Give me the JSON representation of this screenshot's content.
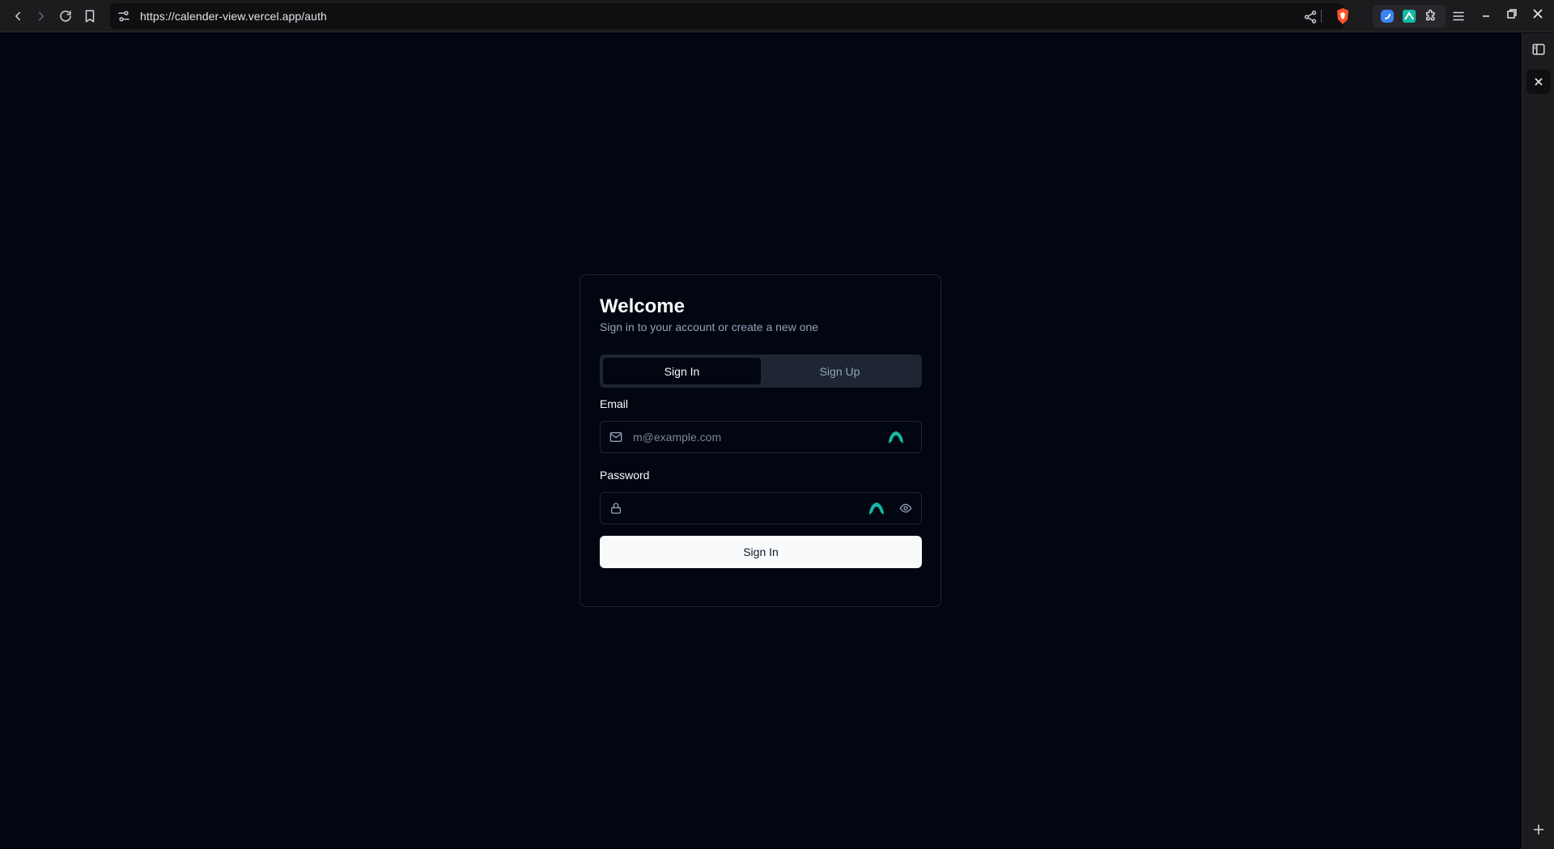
{
  "browser": {
    "url": "https://calender-view.vercel.app/auth"
  },
  "auth": {
    "title": "Welcome",
    "subtitle": "Sign in to your account or create a new one",
    "tabs": [
      {
        "label": "Sign In",
        "active": true
      },
      {
        "label": "Sign Up",
        "active": false
      }
    ],
    "email": {
      "label": "Email",
      "placeholder": "m@example.com",
      "value": ""
    },
    "password": {
      "label": "Password",
      "placeholder": "",
      "value": ""
    },
    "submit_label": "Sign In"
  },
  "icons": {
    "back": "arrow-left-icon",
    "forward": "arrow-right-icon",
    "reload": "reload-icon",
    "bookmark": "bookmark-icon",
    "site_info": "tune-icon",
    "share": "share-icon",
    "brave": "brave-shield-icon",
    "mail": "mail-icon",
    "lock": "lock-icon",
    "eye": "eye-icon"
  },
  "colors": {
    "page_bg": "#020611",
    "accent_teal": "#14b8a6",
    "primary_button": "#f8fafc"
  }
}
